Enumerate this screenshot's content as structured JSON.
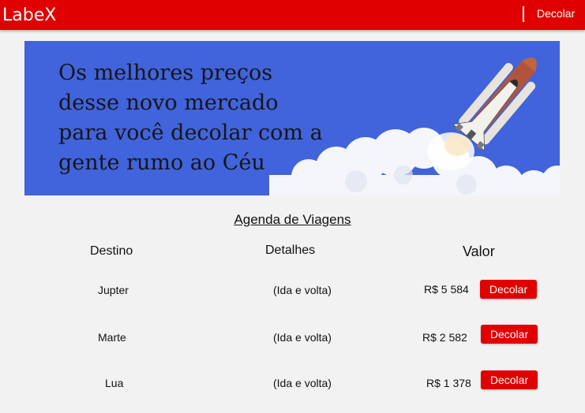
{
  "header": {
    "logo": "LabeX",
    "nav_link": "Decolar"
  },
  "hero": {
    "lines": [
      "Os melhores preços",
      "desse novo mercado",
      "para você decolar com a",
      "gente rumo ao Céu"
    ],
    "background": "#4163dc"
  },
  "agenda": {
    "title": "Agenda de Viagens",
    "columns": {
      "destination": "Destino",
      "details": "Detalhes",
      "price": "Valor"
    },
    "rows": [
      {
        "destination": "Jupter",
        "details": "(Ida e volta)",
        "price": "R$ 5 584",
        "button": "Decolar"
      },
      {
        "destination": "Marte",
        "details": "(Ida e volta)",
        "price": "R$ 2 582",
        "button": "Decolar"
      },
      {
        "destination": "Lua",
        "details": "(Ida e volta)",
        "price": "R$ 1 378",
        "button": "Decolar"
      }
    ]
  },
  "colors": {
    "brand_red": "#e00000",
    "page_bg": "#f2f2f2"
  },
  "icons": {
    "hero_image": "space-shuttle-launch-icon"
  }
}
